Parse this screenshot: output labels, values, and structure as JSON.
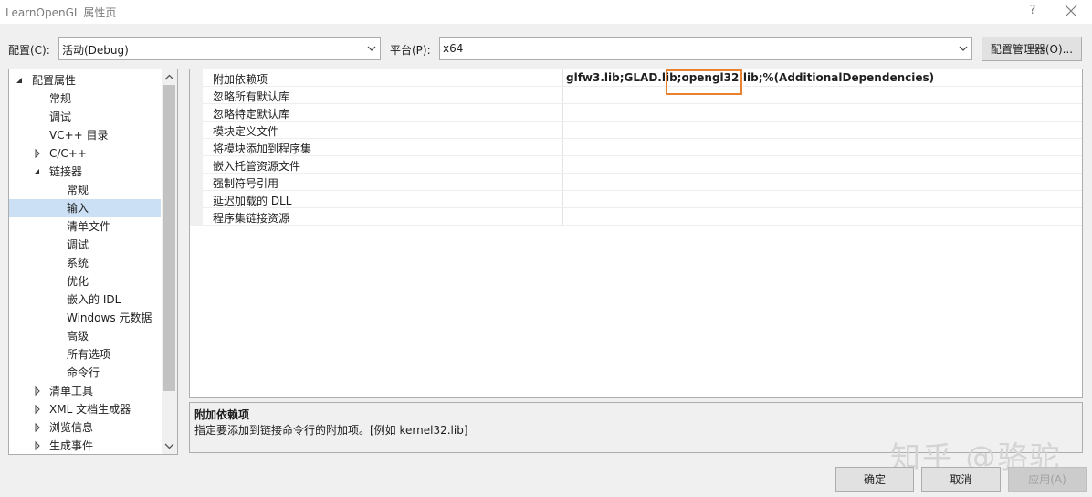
{
  "window": {
    "title": "LearnOpenGL 属性页",
    "help": "?"
  },
  "config": {
    "config_label": "配置(C):",
    "config_value": "活动(Debug)",
    "platform_label": "平台(P):",
    "platform_value": "x64",
    "manager_button": "配置管理器(O)..."
  },
  "tree": {
    "items": [
      {
        "label": "配置属性",
        "expander": "expanded"
      },
      {
        "label": "常规"
      },
      {
        "label": "调试"
      },
      {
        "label": "VC++ 目录"
      },
      {
        "label": "C/C++",
        "expander": "collapsed"
      },
      {
        "label": "链接器",
        "expander": "expanded"
      },
      {
        "label": "常规"
      },
      {
        "label": "输入",
        "selected": true
      },
      {
        "label": "清单文件"
      },
      {
        "label": "调试"
      },
      {
        "label": "系统"
      },
      {
        "label": "优化"
      },
      {
        "label": "嵌入的 IDL"
      },
      {
        "label": "Windows 元数据"
      },
      {
        "label": "高级"
      },
      {
        "label": "所有选项"
      },
      {
        "label": "命令行"
      },
      {
        "label": "清单工具",
        "expander": "collapsed"
      },
      {
        "label": "XML 文档生成器",
        "expander": "collapsed"
      },
      {
        "label": "浏览信息",
        "expander": "collapsed"
      },
      {
        "label": "生成事件",
        "expander": "collapsed"
      }
    ]
  },
  "properties": {
    "rows": [
      {
        "name": "附加依赖项",
        "value": "glfw3.lib;GLAD.lib;opengl32.lib;%(AdditionalDependencies)"
      },
      {
        "name": "忽略所有默认库",
        "value": ""
      },
      {
        "name": "忽略特定默认库",
        "value": ""
      },
      {
        "name": "模块定义文件",
        "value": ""
      },
      {
        "name": "将模块添加到程序集",
        "value": ""
      },
      {
        "name": "嵌入托管资源文件",
        "value": ""
      },
      {
        "name": "强制符号引用",
        "value": ""
      },
      {
        "name": "延迟加载的 DLL",
        "value": ""
      },
      {
        "name": "程序集链接资源",
        "value": ""
      }
    ],
    "highlight_color": "#e8822e"
  },
  "description": {
    "title": "附加依赖项",
    "text": "指定要添加到链接命令行的附加项。[例如 kernel32.lib]"
  },
  "buttons": {
    "ok": "确定",
    "cancel": "取消",
    "apply": "应用(A)"
  },
  "watermark": "知乎 @骆驼"
}
